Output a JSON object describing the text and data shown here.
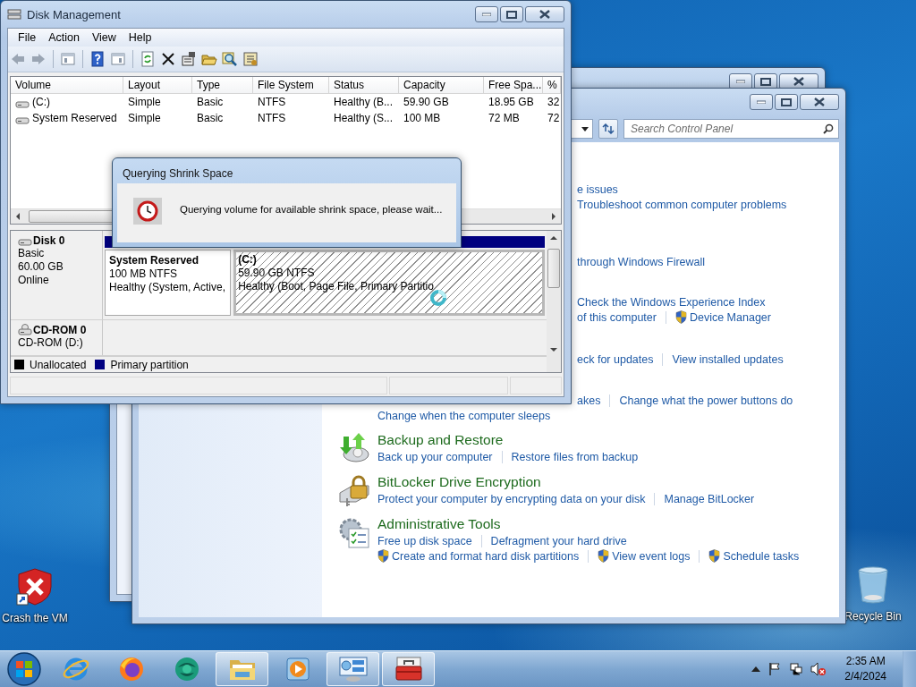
{
  "disk_management": {
    "title": "Disk Management",
    "menu": [
      "File",
      "Action",
      "View",
      "Help"
    ],
    "volume_table": {
      "columns": [
        "Volume",
        "Layout",
        "Type",
        "File System",
        "Status",
        "Capacity",
        "Free Spa...",
        "%"
      ],
      "rows": [
        [
          "(C:)",
          "Simple",
          "Basic",
          "NTFS",
          "Healthy (B...",
          "59.90 GB",
          "18.95 GB",
          "32"
        ],
        [
          "System Reserved",
          "Simple",
          "Basic",
          "NTFS",
          "Healthy (S...",
          "100 MB",
          "72 MB",
          "72"
        ]
      ]
    },
    "disks": [
      {
        "kind": "disk",
        "name": "Disk 0",
        "lines": [
          "Basic",
          "60.00 GB",
          "Online"
        ],
        "partitions": [
          {
            "name": "System Reserved",
            "size": "100 MB NTFS",
            "status": "Healthy (System, Active,",
            "selected": false
          },
          {
            "name": "(C:)",
            "size": "59.90 GB NTFS",
            "status": "Healthy (Boot, Page File, Primary Partitio",
            "selected": true
          }
        ]
      },
      {
        "kind": "cdrom",
        "name": "CD-ROM 0",
        "lines": [
          "CD-ROM (D:)"
        ]
      }
    ],
    "legend": [
      {
        "label": "Unallocated",
        "color": "#000000"
      },
      {
        "label": "Primary partition",
        "color": "#000080"
      }
    ],
    "dialog": {
      "title": "Querying Shrink Space",
      "message": "Querying volume for available shrink space, please wait..."
    }
  },
  "control_panel": {
    "search": {
      "placeholder": "Search Control Panel"
    },
    "cut_groups": [
      [
        {
          "kind": "cut",
          "links": [
            {
              "text": "e issues",
              "shield": false
            }
          ]
        },
        {
          "kind": "cut",
          "links": [
            {
              "text": "Troubleshoot common computer problems",
              "shield": false
            }
          ]
        }
      ],
      [
        {
          "kind": "cut",
          "links": [
            {
              "text": "through Windows Firewall",
              "shield": false
            }
          ]
        }
      ],
      [
        {
          "kind": "cut",
          "links": [
            {
              "text": "Check the Windows Experience Index",
              "shield": false
            }
          ]
        },
        {
          "kind": "cut",
          "links": [
            {
              "text": "of this computer",
              "shield": false
            },
            {
              "text": "Device Manager",
              "shield": true
            }
          ]
        }
      ],
      [
        {
          "kind": "cut",
          "links": [
            {
              "text": "eck for updates",
              "shield": false
            },
            {
              "text": "View installed updates",
              "shield": false
            }
          ]
        }
      ],
      [
        {
          "kind": "cut",
          "links": [
            {
              "text": "akes",
              "shield": false
            },
            {
              "text": "Change what the power buttons do",
              "shield": false
            }
          ]
        },
        {
          "kind": "full",
          "links": [
            {
              "text": "Change when the computer sleeps",
              "shield": false
            }
          ]
        }
      ]
    ],
    "categories": [
      {
        "kind": "backup",
        "title": "Backup and Restore",
        "rows": [
          [
            {
              "text": "Back up your computer",
              "shield": false
            },
            {
              "text": "Restore files from backup",
              "shield": false
            }
          ]
        ]
      },
      {
        "kind": "bitlocker",
        "title": "BitLocker Drive Encryption",
        "rows": [
          [
            {
              "text": "Protect your computer by encrypting data on your disk",
              "shield": false
            },
            {
              "text": "Manage BitLocker",
              "shield": false
            }
          ]
        ]
      },
      {
        "kind": "admin",
        "title": "Administrative Tools",
        "rows": [
          [
            {
              "text": "Free up disk space",
              "shield": false
            },
            {
              "text": "Defragment your hard drive",
              "shield": false
            }
          ],
          [
            {
              "text": "Create and format hard disk partitions",
              "shield": true
            },
            {
              "text": "View event logs",
              "shield": true
            },
            {
              "text": "Schedule tasks",
              "shield": true
            }
          ]
        ]
      }
    ]
  },
  "desktop_icons": [
    {
      "kind": "shield",
      "label": "Crash the VM"
    },
    {
      "kind": "recycle",
      "label": "Recycle Bin"
    }
  ],
  "taskbar": {
    "apps": [
      {
        "kind": "ie",
        "open": false
      },
      {
        "kind": "firefox",
        "open": false
      },
      {
        "kind": "globe",
        "open": false
      },
      {
        "kind": "explorer",
        "open": true
      },
      {
        "kind": "media",
        "open": false
      },
      {
        "kind": "control",
        "open": true
      },
      {
        "kind": "toolbox",
        "open": true
      }
    ],
    "clock": {
      "time": "2:35 AM",
      "date": "2/4/2024"
    }
  }
}
